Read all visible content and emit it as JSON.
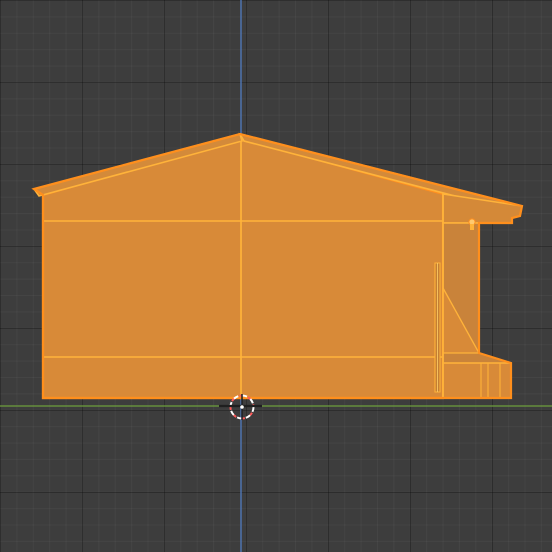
{
  "viewport": {
    "view": "orthographic-front",
    "grid": true,
    "background_color": "#3d3d3d"
  },
  "colors": {
    "selection_fill": "#d88a38",
    "selection_edge": "#ffb33a",
    "active_outline": "#ff8f1f",
    "z_axis": "#4f77b7",
    "x_axis": "#6e9e3d",
    "cursor_red": "#ff5a5a",
    "cursor_white": "#ffffff"
  },
  "scene": {
    "object_type": "house-mesh",
    "selected": true,
    "has_porch_overhang": true,
    "has_cursor": true
  }
}
